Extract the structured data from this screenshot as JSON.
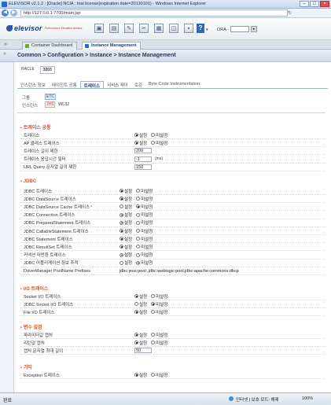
{
  "window": {
    "title": "ELEVISOR v2.1.2 : [Oracle] NCIA : trial license(expiration date=20130101) - Windows Internet Explorer",
    "url": "http://127.0.0.1:7700/main.jsp"
  },
  "header": {
    "logo": "elevisor",
    "logo_sub": "Performance Elevation Advisor",
    "help": "?",
    "ora_label": "ORA -",
    "ora_value": "",
    "toolbar_icons": [
      "monitor-icon",
      "report-icon",
      "settings-icon",
      "tools-icon",
      "alert-icon",
      "config-icon",
      "screen-icon",
      "chart-icon"
    ]
  },
  "tabs": [
    {
      "label": "Container Dashboard",
      "active": false
    },
    {
      "label": "Instance Management",
      "active": true
    }
  ],
  "breadcrumb": "Common > Configuration > Instance > Instance Management",
  "server_tabs": [
    "RACLE",
    "3203"
  ],
  "main_tabs": [
    "인스턴스 정보",
    "에이전트 공통",
    "트레이스",
    "서비스 제어",
    "로깅",
    "Byte Code Instrumentation"
  ],
  "active_main_tab": 2,
  "group": {
    "label": "그룹",
    "value": "ETC"
  },
  "instance": {
    "label": "인스턴스",
    "value": "JHS",
    "extra": "WL32"
  },
  "radio_labels": {
    "on": "설정",
    "off": "미설정"
  },
  "sections": {
    "trace_common": {
      "title": "트레이스 공통",
      "rows": [
        {
          "label": "트레이스",
          "type": "radio",
          "value": "on"
        },
        {
          "label": "AP 클래스 트레이스",
          "type": "radio",
          "value": "on"
        },
        {
          "label": "트레이스 길이 제한",
          "type": "text",
          "value": "200"
        },
        {
          "label": "트레이스 응답시간 필터",
          "type": "text",
          "value": "-1",
          "unit": "(ms)"
        },
        {
          "label": "URL Query 문자열 길이 제한",
          "type": "text",
          "value": "150"
        }
      ]
    },
    "jdbc": {
      "title": "JDBC",
      "rows": [
        {
          "label": "JDBC 트레이스",
          "type": "radio",
          "value": "on"
        },
        {
          "label": "JDBC DataSource 트레이스",
          "type": "radio",
          "value": "on"
        },
        {
          "label": "JDBC DataSource Cache 트레이스",
          "type": "radio",
          "value": "off",
          "star": "*"
        },
        {
          "label": "JDBC Connection 트레이스",
          "type": "radio",
          "value": "on"
        },
        {
          "label": "JDBC PreparedStatement 트레이스",
          "type": "radio",
          "value": "on"
        },
        {
          "label": "JDBC CallableStatement 트레이스",
          "type": "radio",
          "value": "on"
        },
        {
          "label": "JDBC Statement 트레이스",
          "type": "radio",
          "value": "on"
        },
        {
          "label": "JDBC ResultSet 트레이스",
          "type": "radio",
          "value": "on"
        },
        {
          "label": "커넥션 미반환 트레이스",
          "type": "radio",
          "value": "on"
        },
        {
          "label": "JDBC 어플리케이션 정보 추적",
          "type": "radio",
          "value": "off"
        },
        {
          "label": "DriverManager PoolName Prefixes",
          "type": "plain",
          "value": "jdbc:jeus:pool:,jdbc:weblogic:pool,jdbc:apache:commons:dbcp"
        }
      ]
    },
    "io": {
      "title": "I/O 트레이스",
      "rows": [
        {
          "label": "Socket I/O 트레이스",
          "type": "radio",
          "value": "on"
        },
        {
          "label": "JDBC Socket I/O 트레이스",
          "type": "radio",
          "value": "off"
        },
        {
          "label": "File I/O 트레이스",
          "type": "radio",
          "value": "on"
        }
      ]
    },
    "param": {
      "title": "변수 설정",
      "rows": [
        {
          "label": "파라미터값 캡처",
          "type": "radio",
          "value": "on"
        },
        {
          "label": "리턴값 캡처",
          "type": "radio",
          "value": "on"
        },
        {
          "label": "캡처 문자열 최대 길이",
          "type": "text",
          "value": "50"
        }
      ]
    },
    "etc": {
      "title": "기타",
      "rows": [
        {
          "label": "Exception 트레이스",
          "type": "radio",
          "value": "on"
        }
      ]
    }
  },
  "status": {
    "left": "완료",
    "zone": "인터넷 | 보호 모드: 해제",
    "zoom": "100%"
  }
}
